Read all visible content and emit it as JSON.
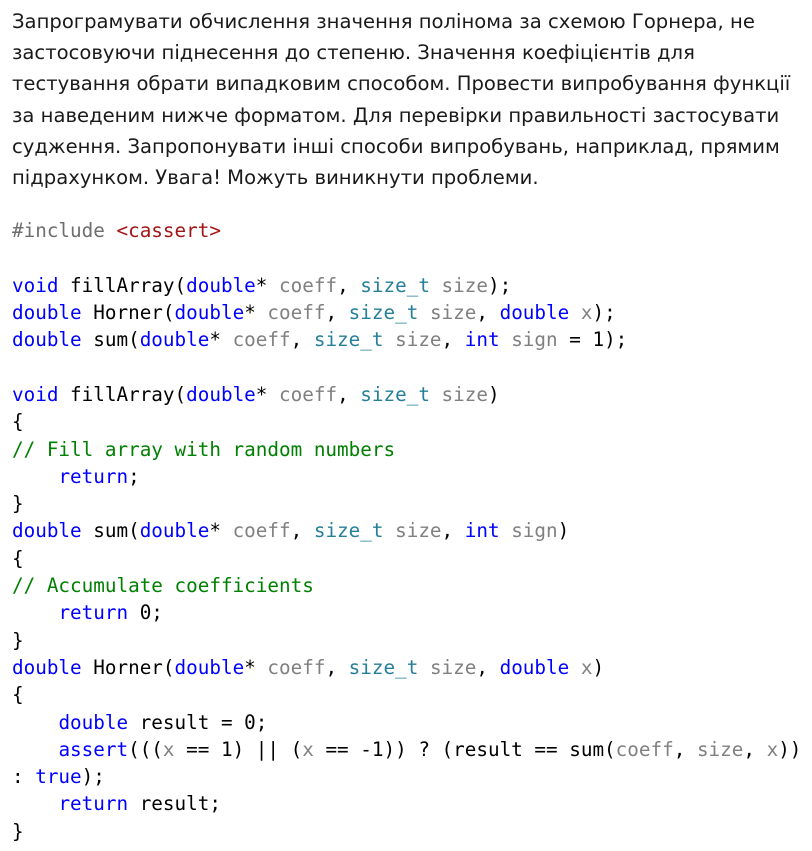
{
  "description": "Запрограмувати обчислення значення полінома за схемою Горнера, не застосовуючи піднесення до степеню. Значення коефіцієнтів для тестування обрати випадковим способом. Провести випробування функції за наведеним нижче форматом. Для перевірки правильності застосувати судження. Запропонувати інші способи випробувань, наприклад, прямим підрахунком. Увага! Можуть виникнути проблеми.",
  "colors": {
    "keyword": "#0000ff",
    "type": "#267f99",
    "parameter": "#808080",
    "comment": "#008000",
    "include_path": "#a31515",
    "preprocessor": "#6e6e6e",
    "text": "#000000"
  },
  "code": [
    [
      {
        "t": "#include ",
        "c": "pp"
      },
      {
        "t": "<cassert>",
        "c": "str"
      }
    ],
    [],
    [
      {
        "t": "void",
        "c": "kw"
      },
      {
        "t": " fillArray("
      },
      {
        "t": "double",
        "c": "kw"
      },
      {
        "t": "* "
      },
      {
        "t": "coeff",
        "c": "param"
      },
      {
        "t": ", "
      },
      {
        "t": "size_t",
        "c": "type"
      },
      {
        "t": " "
      },
      {
        "t": "size",
        "c": "param"
      },
      {
        "t": ");"
      }
    ],
    [
      {
        "t": "double",
        "c": "kw"
      },
      {
        "t": " Horner("
      },
      {
        "t": "double",
        "c": "kw"
      },
      {
        "t": "* "
      },
      {
        "t": "coeff",
        "c": "param"
      },
      {
        "t": ", "
      },
      {
        "t": "size_t",
        "c": "type"
      },
      {
        "t": " "
      },
      {
        "t": "size",
        "c": "param"
      },
      {
        "t": ", "
      },
      {
        "t": "double",
        "c": "kw"
      },
      {
        "t": " "
      },
      {
        "t": "x",
        "c": "param"
      },
      {
        "t": ");"
      }
    ],
    [
      {
        "t": "double",
        "c": "kw"
      },
      {
        "t": " sum("
      },
      {
        "t": "double",
        "c": "kw"
      },
      {
        "t": "* "
      },
      {
        "t": "coeff",
        "c": "param"
      },
      {
        "t": ", "
      },
      {
        "t": "size_t",
        "c": "type"
      },
      {
        "t": " "
      },
      {
        "t": "size",
        "c": "param"
      },
      {
        "t": ", "
      },
      {
        "t": "int",
        "c": "kw"
      },
      {
        "t": " "
      },
      {
        "t": "sign",
        "c": "param"
      },
      {
        "t": " = 1);"
      }
    ],
    [],
    [
      {
        "t": "void",
        "c": "kw"
      },
      {
        "t": " fillArray("
      },
      {
        "t": "double",
        "c": "kw"
      },
      {
        "t": "* "
      },
      {
        "t": "coeff",
        "c": "param"
      },
      {
        "t": ", "
      },
      {
        "t": "size_t",
        "c": "type"
      },
      {
        "t": " "
      },
      {
        "t": "size",
        "c": "param"
      },
      {
        "t": ")"
      }
    ],
    [
      {
        "t": "{"
      }
    ],
    [
      {
        "t": "// Fill array with random numbers",
        "c": "cm"
      }
    ],
    [
      {
        "t": "    "
      },
      {
        "t": "return",
        "c": "kw"
      },
      {
        "t": ";"
      }
    ],
    [
      {
        "t": "}"
      }
    ],
    [
      {
        "t": "double",
        "c": "kw"
      },
      {
        "t": " sum("
      },
      {
        "t": "double",
        "c": "kw"
      },
      {
        "t": "* "
      },
      {
        "t": "coeff",
        "c": "param"
      },
      {
        "t": ", "
      },
      {
        "t": "size_t",
        "c": "type"
      },
      {
        "t": " "
      },
      {
        "t": "size",
        "c": "param"
      },
      {
        "t": ", "
      },
      {
        "t": "int",
        "c": "kw"
      },
      {
        "t": " "
      },
      {
        "t": "sign",
        "c": "param"
      },
      {
        "t": ")"
      }
    ],
    [
      {
        "t": "{"
      }
    ],
    [
      {
        "t": "// Accumulate coefficients",
        "c": "cm"
      }
    ],
    [
      {
        "t": "    "
      },
      {
        "t": "return",
        "c": "kw"
      },
      {
        "t": " 0;"
      }
    ],
    [
      {
        "t": "}"
      }
    ],
    [
      {
        "t": "double",
        "c": "kw"
      },
      {
        "t": " Horner("
      },
      {
        "t": "double",
        "c": "kw"
      },
      {
        "t": "* "
      },
      {
        "t": "coeff",
        "c": "param"
      },
      {
        "t": ", "
      },
      {
        "t": "size_t",
        "c": "type"
      },
      {
        "t": " "
      },
      {
        "t": "size",
        "c": "param"
      },
      {
        "t": ", "
      },
      {
        "t": "double",
        "c": "kw"
      },
      {
        "t": " "
      },
      {
        "t": "x",
        "c": "param"
      },
      {
        "t": ")"
      }
    ],
    [
      {
        "t": "{"
      }
    ],
    [
      {
        "t": "    "
      },
      {
        "t": "double",
        "c": "kw"
      },
      {
        "t": " result = 0;"
      }
    ],
    [
      {
        "t": "    "
      },
      {
        "t": "assert",
        "c": "kw"
      },
      {
        "t": "((("
      },
      {
        "t": "x",
        "c": "param"
      },
      {
        "t": " == 1) || ("
      },
      {
        "t": "x",
        "c": "param"
      },
      {
        "t": " == -1)) ? (result == sum("
      },
      {
        "t": "coeff",
        "c": "param"
      },
      {
        "t": ", "
      },
      {
        "t": "size",
        "c": "param"
      },
      {
        "t": ", "
      },
      {
        "t": "x",
        "c": "param"
      },
      {
        "t": ")) : "
      },
      {
        "t": "true",
        "c": "kw"
      },
      {
        "t": ");"
      }
    ],
    [
      {
        "t": "    "
      },
      {
        "t": "return",
        "c": "kw"
      },
      {
        "t": " result;"
      }
    ],
    [
      {
        "t": "}"
      }
    ]
  ]
}
